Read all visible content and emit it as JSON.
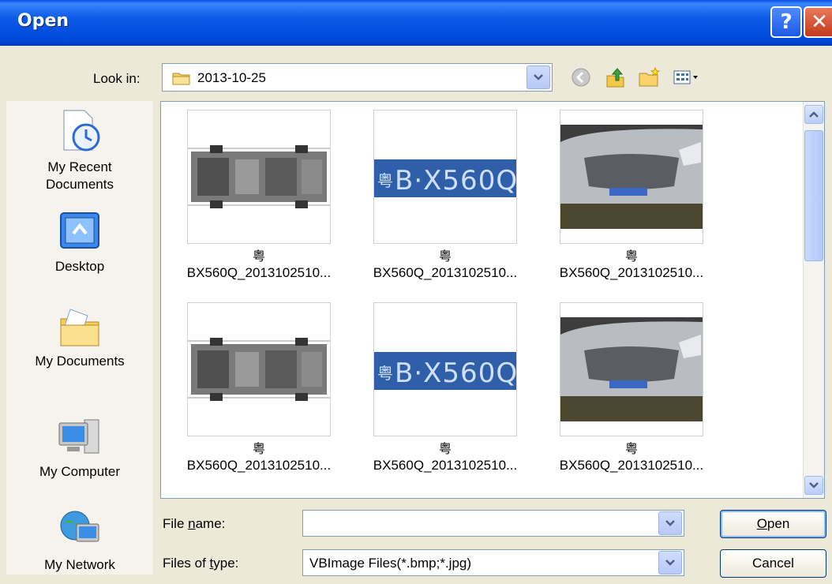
{
  "window": {
    "title": "Open",
    "help_glyph": "?",
    "close_glyph": "✕"
  },
  "toolbar": {
    "look_in_label": "Look in:",
    "look_in_value": "2013-10-25",
    "icons": [
      "back-icon",
      "up-one-level-icon",
      "new-folder-icon",
      "view-menu-icon"
    ]
  },
  "places": [
    {
      "label": "My Recent\nDocuments",
      "icon": "recent-documents-icon"
    },
    {
      "label": "Desktop",
      "icon": "desktop-icon"
    },
    {
      "label": "My Documents",
      "icon": "my-documents-icon"
    },
    {
      "label": "My Computer",
      "icon": "my-computer-icon"
    },
    {
      "label": "My Network",
      "icon": "my-network-icon"
    }
  ],
  "files": [
    {
      "line1": "粤",
      "line2": "BX560Q_2013102510...",
      "kind": "undercarriage"
    },
    {
      "line1": "粤",
      "line2": "BX560Q_2013102510...",
      "kind": "plate"
    },
    {
      "line1": "粤",
      "line2": "BX560Q_2013102510...",
      "kind": "car"
    },
    {
      "line1": "粤",
      "line2": "BX560Q_2013102510...",
      "kind": "undercarriage"
    },
    {
      "line1": "粤",
      "line2": "BX560Q_2013102510...",
      "kind": "plate"
    },
    {
      "line1": "粤",
      "line2": "BX560Q_2013102510...",
      "kind": "car"
    }
  ],
  "plate_text": "粤B·X560Q",
  "plate_lines": [
    "粤",
    "B·X560Q"
  ],
  "form": {
    "file_name_label_pre": "File ",
    "file_name_label_mnemonic": "n",
    "file_name_label_post": "ame:",
    "file_name_value": "",
    "file_type_label_pre": "Files of ",
    "file_type_label_mnemonic": "t",
    "file_type_label_post": "ype:",
    "file_type_value": "VBImage Files(*.bmp;*.jpg)"
  },
  "buttons": {
    "open_mnemonic": "O",
    "open_rest": "pen",
    "cancel": "Cancel"
  },
  "colors": {
    "title_bar": "#0a5ae6",
    "dialog_bg": "#ece9d8",
    "plate_bg": "#2f5fa8"
  }
}
